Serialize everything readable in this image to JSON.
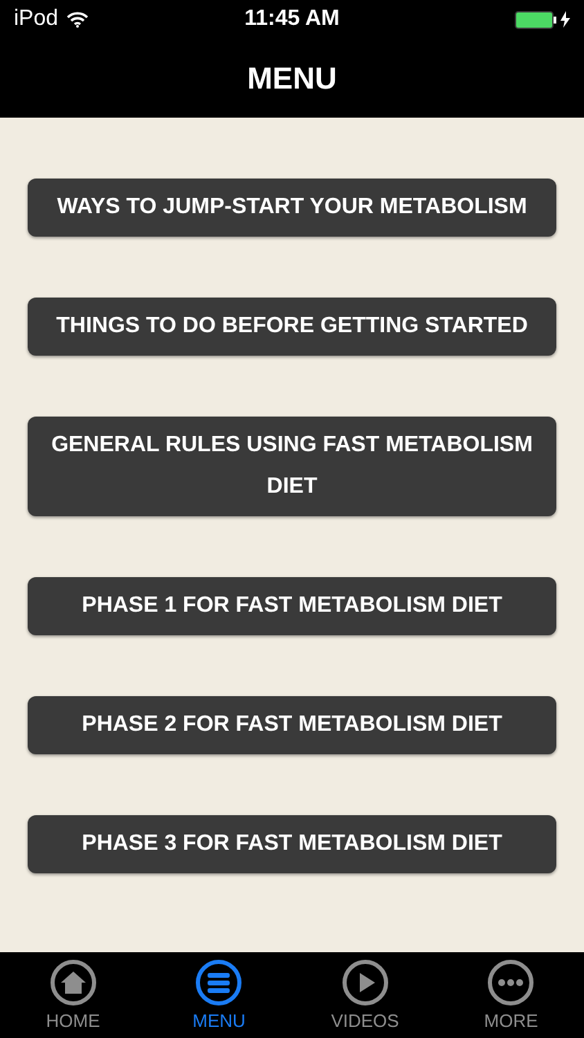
{
  "status_bar": {
    "carrier": "iPod",
    "time": "11:45 AM",
    "charging": true
  },
  "nav_bar": {
    "title": "MENU"
  },
  "menu_items": [
    {
      "label": "WAYS TO JUMP-START YOUR METABOLISM"
    },
    {
      "label": "THINGS TO DO BEFORE GETTING STARTED"
    },
    {
      "label": "GENERAL RULES USING FAST METABOLISM DIET"
    },
    {
      "label": "PHASE 1 FOR FAST METABOLISM DIET"
    },
    {
      "label": "PHASE 2 FOR FAST METABOLISM DIET"
    },
    {
      "label": "PHASE 3 FOR FAST METABOLISM DIET"
    }
  ],
  "tab_bar": [
    {
      "kind": "home",
      "label": "HOME",
      "selected": false
    },
    {
      "kind": "menu",
      "label": "MENU",
      "selected": true
    },
    {
      "kind": "videos",
      "label": "VIDEOS",
      "selected": false
    },
    {
      "kind": "more",
      "label": "MORE",
      "selected": false
    }
  ]
}
